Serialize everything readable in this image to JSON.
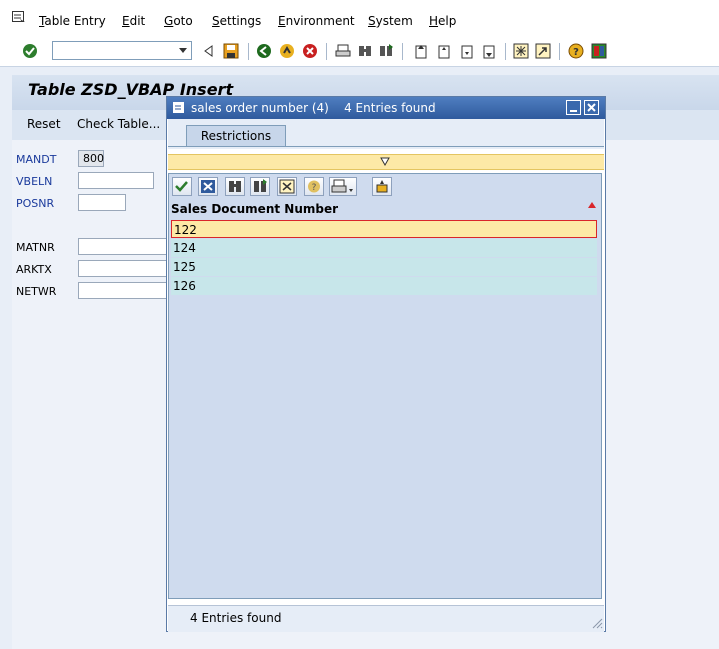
{
  "menu": {
    "items": [
      {
        "label_ul": "T",
        "label_rest": "able Entry"
      },
      {
        "label_ul": "E",
        "label_rest": "dit"
      },
      {
        "label_ul": "G",
        "label_rest": "oto"
      },
      {
        "label_ul": "S",
        "label_rest": "ettings"
      },
      {
        "label_ul": "E",
        "label_rest": "nvironment"
      },
      {
        "label_ul": "S",
        "label_rest": "ystem"
      },
      {
        "label_ul": "H",
        "label_rest": "elp"
      }
    ]
  },
  "toolbar": {
    "command_value": ""
  },
  "screen": {
    "title": "Table ZSD_VBAP Insert",
    "buttons": {
      "reset": "Reset",
      "check_table": "Check Table..."
    },
    "fields": {
      "mandt": {
        "label": "MANDT",
        "value": "800"
      },
      "vbeln": {
        "label": "VBELN",
        "value": ""
      },
      "posnr": {
        "label": "POSNR",
        "value": ""
      },
      "matnr": {
        "label": "MATNR",
        "value": ""
      },
      "arktx": {
        "label": "ARKTX",
        "value": ""
      },
      "netwr": {
        "label": "NETWR",
        "value": ""
      }
    }
  },
  "popup": {
    "title": "sales order number (4)    4 Entries found",
    "tab": "Restrictions",
    "column_header": "Sales Document Number",
    "rows": [
      "122",
      "124",
      "125",
      "126"
    ],
    "status": "4 Entries found"
  },
  "colors": {
    "selected_row": "#fde9a6",
    "row_bg": "#c7e6ea",
    "label_blue": "#1a3a9c",
    "popup_header": "#2f5a9d"
  }
}
